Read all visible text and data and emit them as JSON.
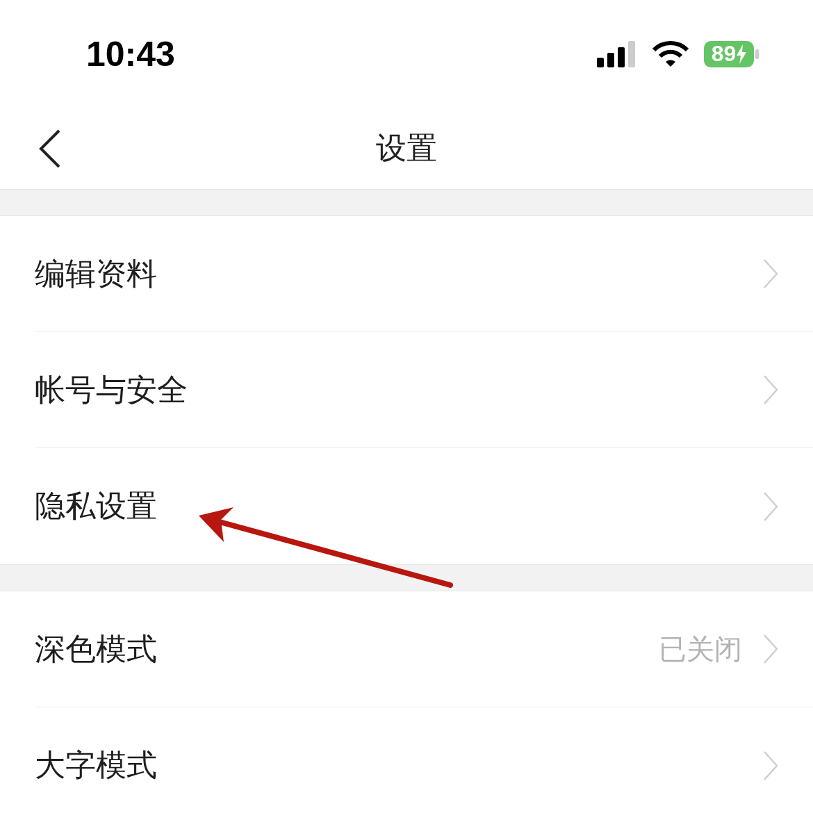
{
  "status_bar": {
    "time": "10:43",
    "battery": "89"
  },
  "nav": {
    "title": "设置"
  },
  "groups": [
    {
      "items": [
        {
          "label": "编辑资料"
        },
        {
          "label": "帐号与安全"
        },
        {
          "label": "隐私设置"
        }
      ]
    },
    {
      "items": [
        {
          "label": "深色模式",
          "value": "已关闭"
        },
        {
          "label": "大字模式"
        }
      ]
    }
  ],
  "annotation": {
    "kind": "arrow"
  }
}
